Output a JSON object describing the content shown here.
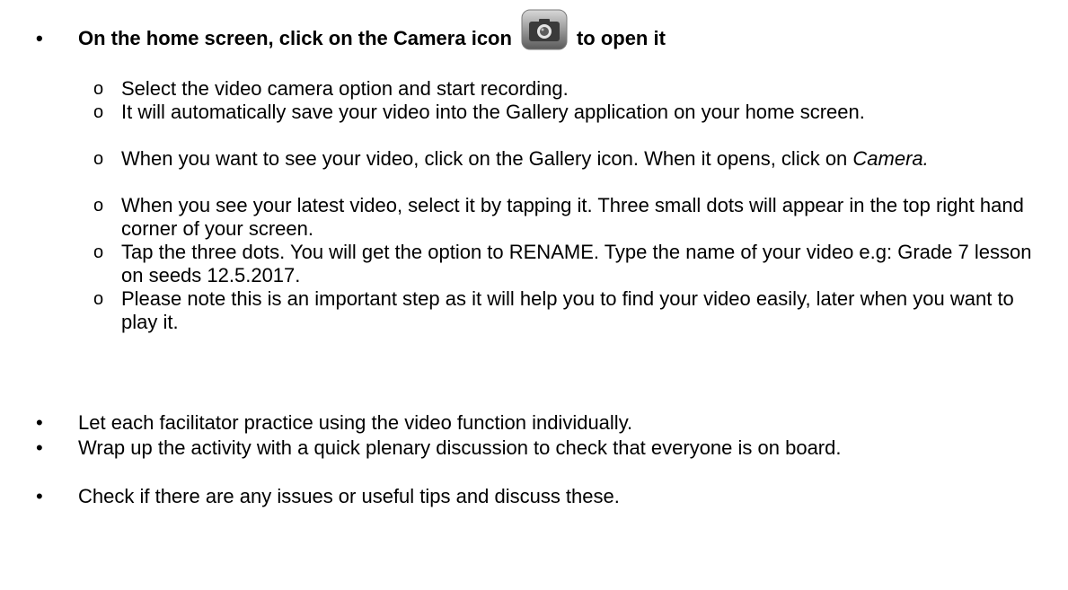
{
  "main_bullet": {
    "text_before_icon": "On the home screen, click on the Camera icon",
    "text_after_icon": "to open it",
    "icon": "camera-icon"
  },
  "steps": [
    {
      "text": "Select the video camera option and start recording."
    },
    {
      "text": "It will automatically save your video into the Gallery application on your home screen."
    },
    {
      "text_before": "When you want to see your video, click on the Gallery icon. When it opens, click on ",
      "text_italic": "Camera."
    },
    {
      "text": "When you see your latest video, select it by tapping it. Three small dots will appear in the top right hand corner of your screen."
    },
    {
      "text": "Tap the three dots. You will get the option to RENAME. Type the name of your video e.g: Grade 7 lesson on seeds 12.5.2017."
    },
    {
      "text": "Please note this is an important step as it will help you to find your video easily, later when you want to play it."
    }
  ],
  "bullets": [
    {
      "text": "Let each facilitator practice using the video function individually."
    },
    {
      "text": "Wrap up the activity with a quick plenary discussion to check that everyone is on board."
    },
    {
      "text": "Check if there are any issues or useful tips and discuss these."
    }
  ]
}
